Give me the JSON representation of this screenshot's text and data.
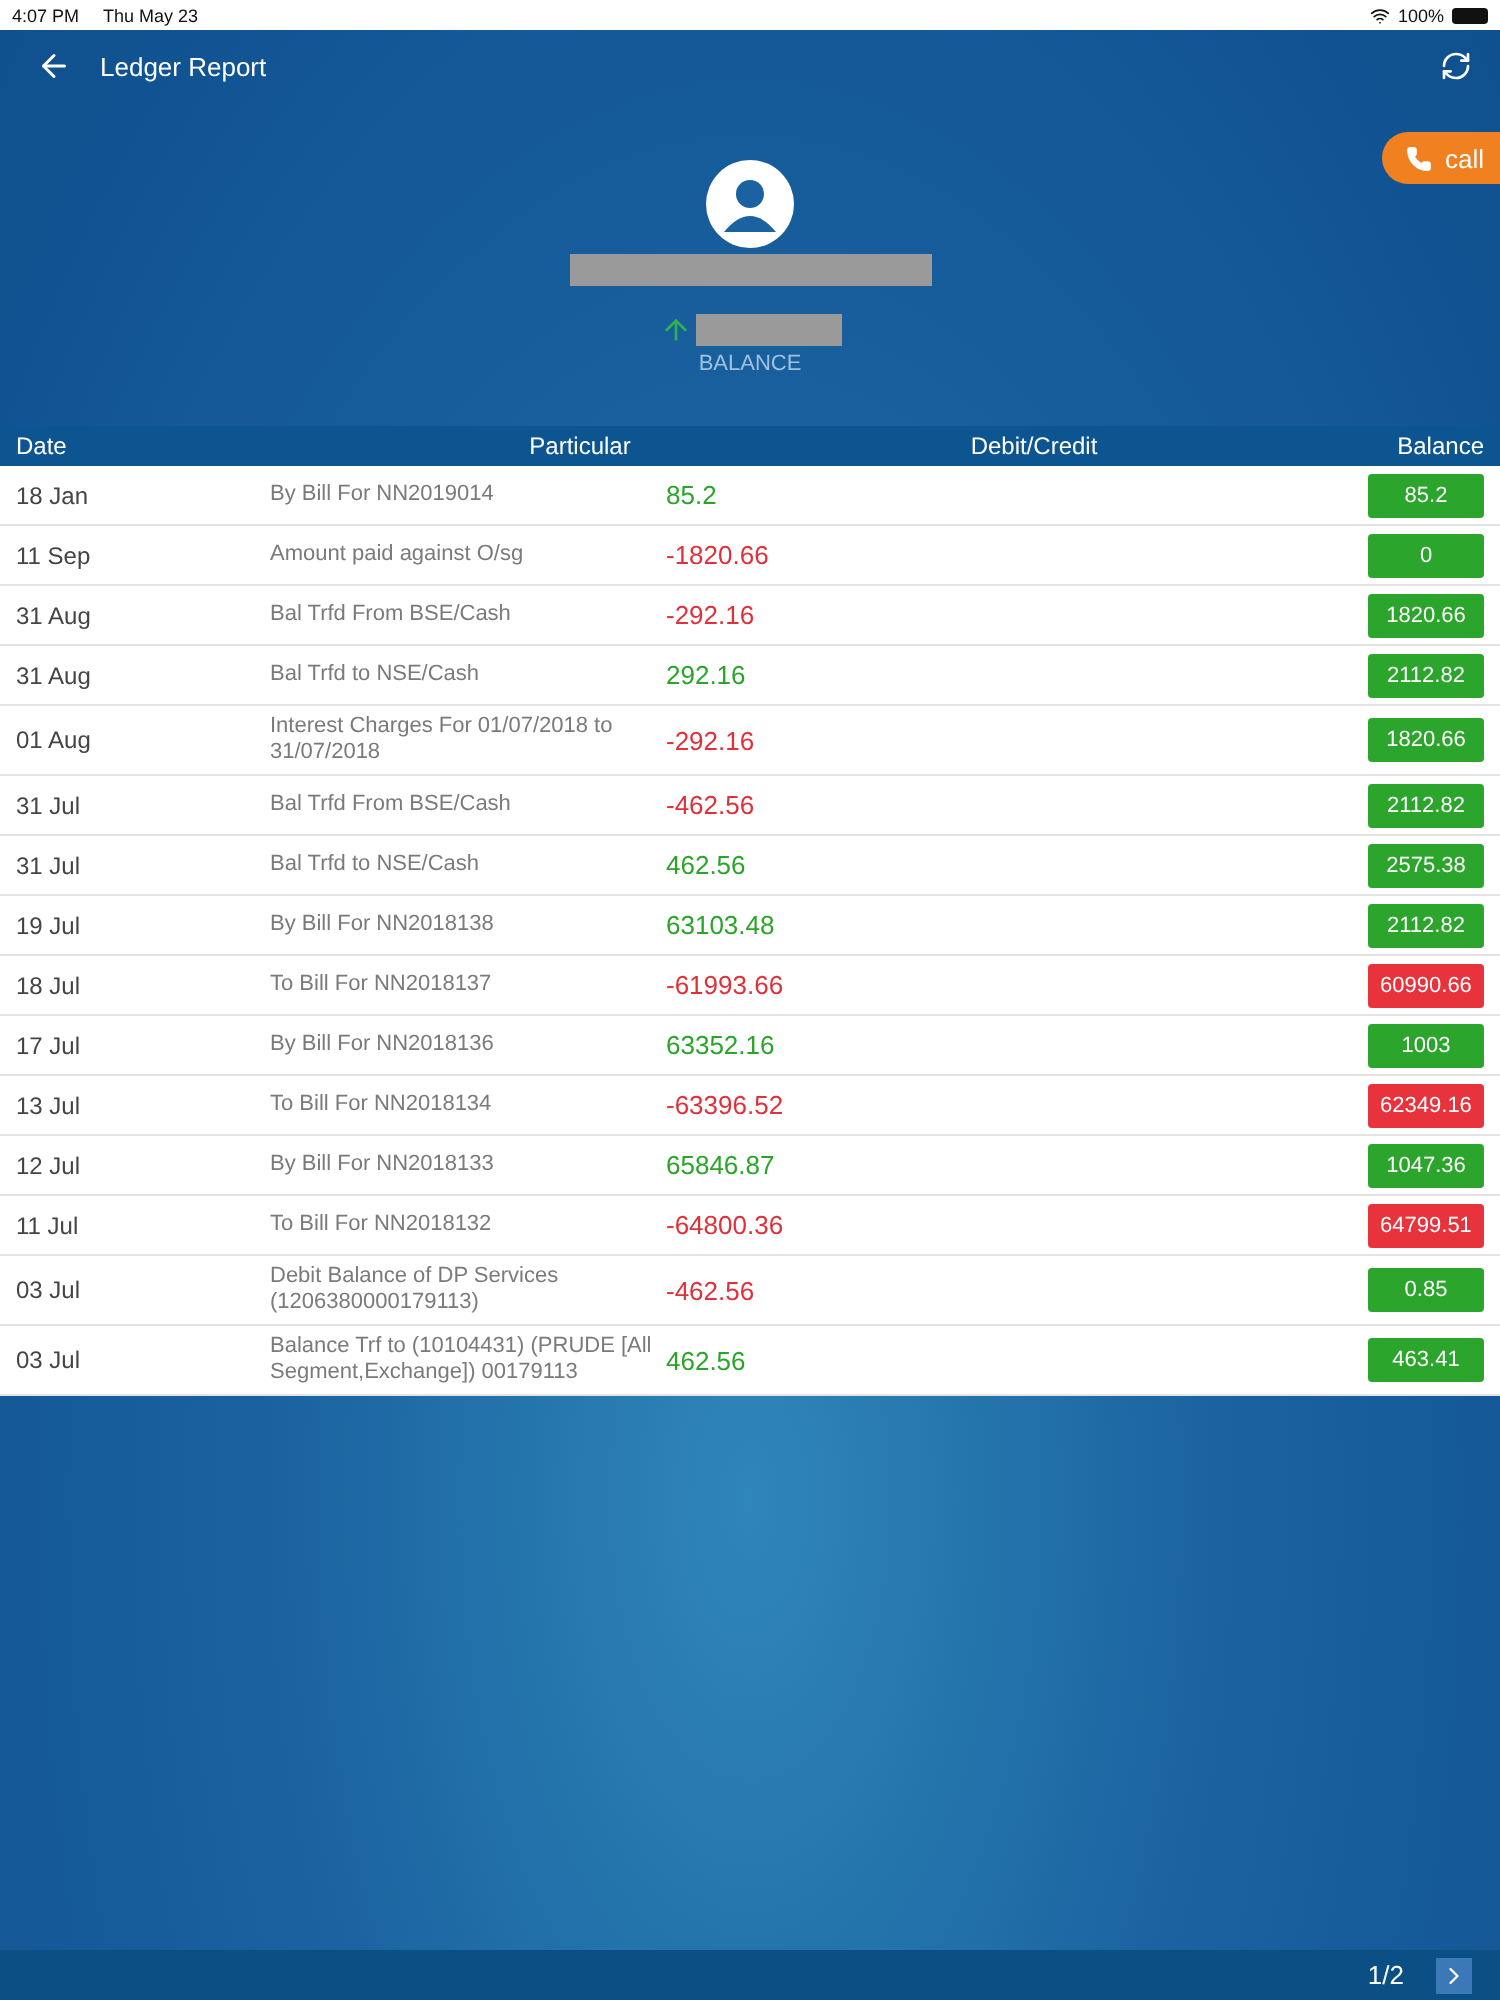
{
  "status_bar": {
    "time": "4:07 PM",
    "date": "Thu May 23",
    "battery": "100%"
  },
  "header": {
    "title": "Ledger Report",
    "call_label": "call",
    "balance_label": "BALANCE"
  },
  "table": {
    "columns": [
      "Date",
      "Particular",
      "Debit/Credit",
      "Balance"
    ],
    "rows": [
      {
        "date": "18 Jan",
        "particular": "By Bill For NN2019014",
        "amount": "85.2",
        "kind": "credit",
        "balance": "85.2",
        "color": "#2ba52c"
      },
      {
        "date": "11 Sep",
        "particular": "Amount paid against O/sg",
        "amount": "-1820.66",
        "kind": "debit",
        "balance": "0",
        "color": "#2ba52c"
      },
      {
        "date": "31 Aug",
        "particular": "Bal Trfd From BSE/Cash",
        "amount": "-292.16",
        "kind": "debit",
        "balance": "1820.66",
        "color": "#2ba52c"
      },
      {
        "date": "31 Aug",
        "particular": "Bal Trfd to NSE/Cash",
        "amount": "292.16",
        "kind": "credit",
        "balance": "2112.82",
        "color": "#2ba52c"
      },
      {
        "date": "01 Aug",
        "particular": "Interest Charges For 01/07/2018 to 31/07/2018",
        "amount": "-292.16",
        "kind": "debit",
        "balance": "1820.66",
        "color": "#2ba52c"
      },
      {
        "date": "31 Jul",
        "particular": "Bal Trfd From BSE/Cash",
        "amount": "-462.56",
        "kind": "debit",
        "balance": "2112.82",
        "color": "#2ba52c"
      },
      {
        "date": "31 Jul",
        "particular": "Bal Trfd to NSE/Cash",
        "amount": "462.56",
        "kind": "credit",
        "balance": "2575.38",
        "color": "#2ba52c"
      },
      {
        "date": "19 Jul",
        "particular": "By Bill For NN2018138",
        "amount": "63103.48",
        "kind": "credit",
        "balance": "2112.82",
        "color": "#2ba52c"
      },
      {
        "date": "18 Jul",
        "particular": "To Bill For NN2018137",
        "amount": "-61993.66",
        "kind": "debit",
        "balance": "60990.66",
        "color": "#e8323c"
      },
      {
        "date": "17 Jul",
        "particular": "By Bill For NN2018136",
        "amount": "63352.16",
        "kind": "credit",
        "balance": "1003",
        "color": "#2ba52c"
      },
      {
        "date": "13 Jul",
        "particular": "To Bill For NN2018134",
        "amount": "-63396.52",
        "kind": "debit",
        "balance": "62349.16",
        "color": "#e8323c"
      },
      {
        "date": "12 Jul",
        "particular": "By Bill For NN2018133",
        "amount": "65846.87",
        "kind": "credit",
        "balance": "1047.36",
        "color": "#2ba52c"
      },
      {
        "date": "11 Jul",
        "particular": "To Bill For NN2018132",
        "amount": "-64800.36",
        "kind": "debit",
        "balance": "64799.51",
        "color": "#e8323c"
      },
      {
        "date": "03 Jul",
        "particular": "Debit Balance of DP Services (1206380000179113)",
        "amount": "-462.56",
        "kind": "debit",
        "balance": "0.85",
        "color": "#2ba52c"
      },
      {
        "date": "03 Jul",
        "particular": "Balance Trf to (10104431) (PRUDE [All Segment,Exchange]) 00179113",
        "amount": "462.56",
        "kind": "credit",
        "balance": "463.41",
        "color": "#2ba52c"
      }
    ]
  },
  "pagination": {
    "label": "1/2"
  }
}
